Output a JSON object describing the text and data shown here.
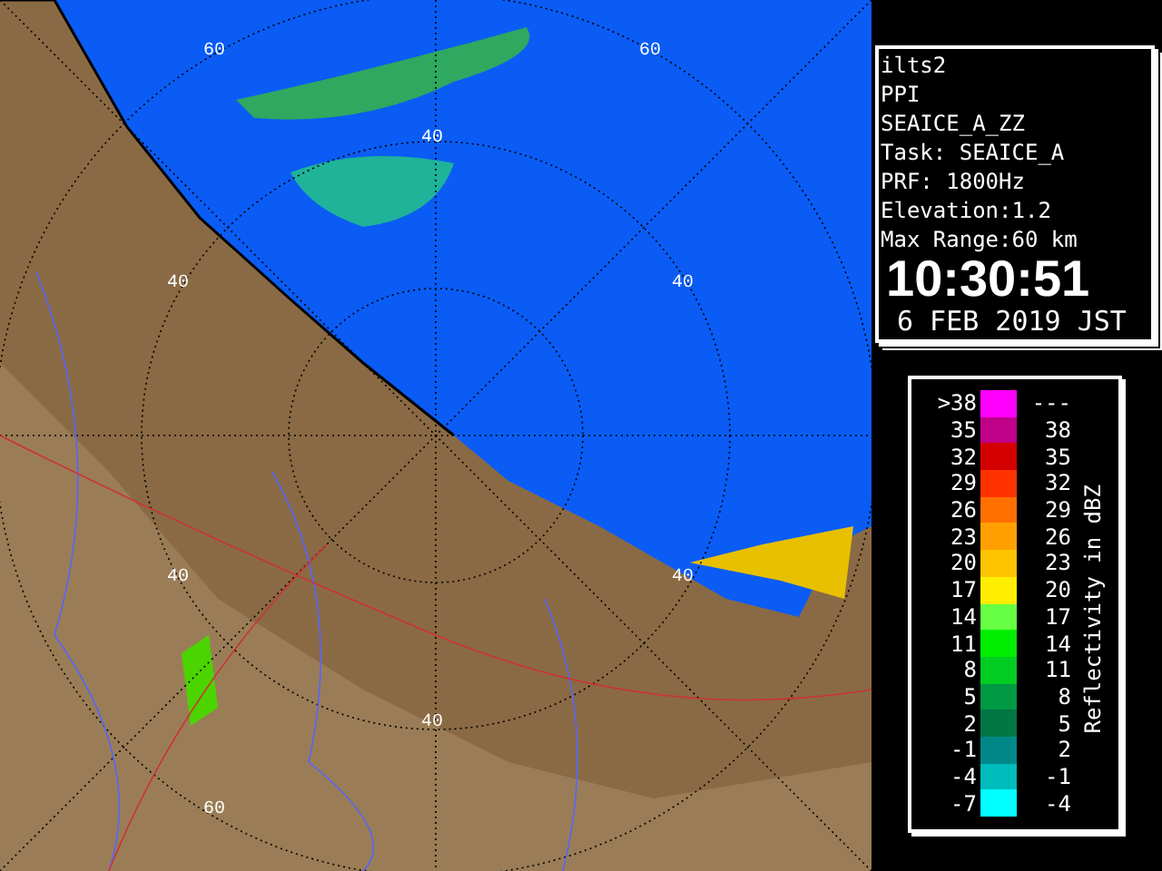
{
  "map": {
    "range_labels": [
      "60",
      "60",
      "40",
      "40",
      "40",
      "40",
      "40",
      "40",
      "60"
    ]
  },
  "info": {
    "lines": [
      "ilts2",
      "PPI",
      "SEAICE_A_ZZ",
      "Task: SEAICE_A",
      "PRF: 1800Hz",
      "Elevation:1.2",
      "Max Range:60 km"
    ],
    "time": "10:30:51",
    "date": "6 FEB 2019 JST"
  },
  "legend": {
    "title": "Reflectivity in dBZ",
    "rows": [
      {
        "low": ">38",
        "high": "---",
        "color": "#ff00ff"
      },
      {
        "low": "35",
        "high": "38",
        "color": "#c00088"
      },
      {
        "low": "32",
        "high": "35",
        "color": "#d40000"
      },
      {
        "low": "29",
        "high": "32",
        "color": "#ff3300"
      },
      {
        "low": "26",
        "high": "29",
        "color": "#ff7000"
      },
      {
        "low": "23",
        "high": "26",
        "color": "#ffa000"
      },
      {
        "low": "20",
        "high": "23",
        "color": "#ffc400"
      },
      {
        "low": "17",
        "high": "20",
        "color": "#ffee00"
      },
      {
        "low": "14",
        "high": "17",
        "color": "#66ff44"
      },
      {
        "low": "11",
        "high": "14",
        "color": "#00ee00"
      },
      {
        "low": "8",
        "high": "11",
        "color": "#00cc22"
      },
      {
        "low": "5",
        "high": "8",
        "color": "#009944"
      },
      {
        "low": "2",
        "high": "5",
        "color": "#007744"
      },
      {
        "low": "-1",
        "high": "2",
        "color": "#008888"
      },
      {
        "low": "-4",
        "high": "-1",
        "color": "#00bbbb"
      },
      {
        "low": "-7",
        "high": "-4",
        "color": "#00ffff"
      }
    ]
  }
}
